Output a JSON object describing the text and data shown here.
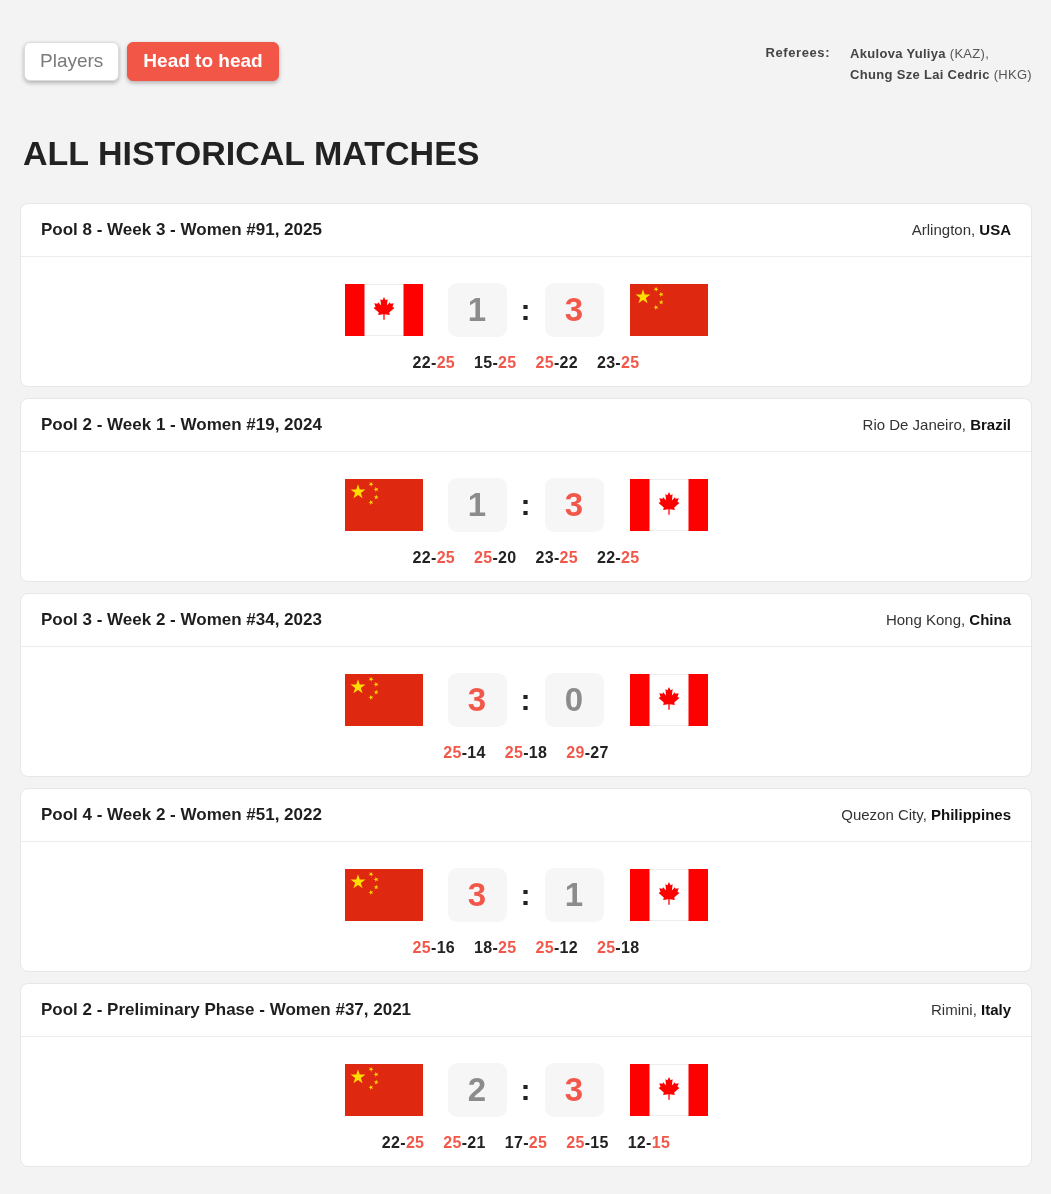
{
  "tabs": [
    {
      "label": "Players",
      "selected": false
    },
    {
      "label": "Head to head",
      "selected": true
    }
  ],
  "referees": {
    "label": "Referees:",
    "entries": [
      "**Akulova Yuliya** (KAZ),",
      "**Chung Sze Lai Cedric** (HKG)"
    ]
  },
  "heading": "ALL HISTORICAL MATCHES",
  "matches": [
    {
      "title": "Pool 8 - Week 3 - Women #91, 2025",
      "location": "Arlington, **USA**",
      "home": {
        "kind": "canada",
        "score": "1",
        "winner": false
      },
      "separator": ":",
      "away": {
        "kind": "china",
        "score": "3",
        "winner": true
      },
      "sets": [
        {
          "score": "22-25",
          "home_won": false
        },
        {
          "score": "15-25",
          "home_won": false
        },
        {
          "score": "25-22",
          "home_won": true
        },
        {
          "score": "23-25",
          "home_won": false
        }
      ]
    },
    {
      "title": "Pool 2 - Week 1 - Women #19, 2024",
      "location": "Rio De Janeiro, **Brazil**",
      "home": {
        "kind": "china",
        "score": "1",
        "winner": false
      },
      "separator": ":",
      "away": {
        "kind": "canada",
        "score": "3",
        "winner": true
      },
      "sets": [
        {
          "score": "22-25",
          "home_won": false
        },
        {
          "score": "25-20",
          "home_won": true
        },
        {
          "score": "23-25",
          "home_won": false
        },
        {
          "score": "22-25",
          "home_won": false
        }
      ]
    },
    {
      "title": "Pool 3 - Week 2 - Women #34, 2023",
      "location": "Hong Kong, **China**",
      "home": {
        "kind": "china",
        "score": "3",
        "winner": true
      },
      "separator": ":",
      "away": {
        "kind": "canada",
        "score": "0",
        "winner": false
      },
      "sets": [
        {
          "score": "25-14",
          "home_won": true
        },
        {
          "score": "25-18",
          "home_won": true
        },
        {
          "score": "29-27",
          "home_won": true
        }
      ]
    },
    {
      "title": "Pool 4 - Week 2 - Women #51, 2022",
      "location": "Quezon City, **Philippines**",
      "home": {
        "kind": "china",
        "score": "3",
        "winner": true
      },
      "separator": ":",
      "away": {
        "kind": "canada",
        "score": "1",
        "winner": false
      },
      "sets": [
        {
          "score": "25-16",
          "home_won": true
        },
        {
          "score": "18-25",
          "home_won": false
        },
        {
          "score": "25-12",
          "home_won": true
        },
        {
          "score": "25-18",
          "home_won": true
        }
      ]
    },
    {
      "title": "Pool 2 - Preliminary Phase - Women #37, 2021",
      "location": "Rimini, **Italy**",
      "home": {
        "kind": "china",
        "score": "2",
        "winner": false
      },
      "separator": ":",
      "away": {
        "kind": "canada",
        "score": "3",
        "winner": true
      },
      "sets": [
        {
          "score": "22-25",
          "home_won": false
        },
        {
          "score": "25-21",
          "home_won": true
        },
        {
          "score": "17-25",
          "home_won": false
        },
        {
          "score": "25-15",
          "home_won": true
        },
        {
          "score": "12-15",
          "home_won": false
        }
      ]
    }
  ]
}
